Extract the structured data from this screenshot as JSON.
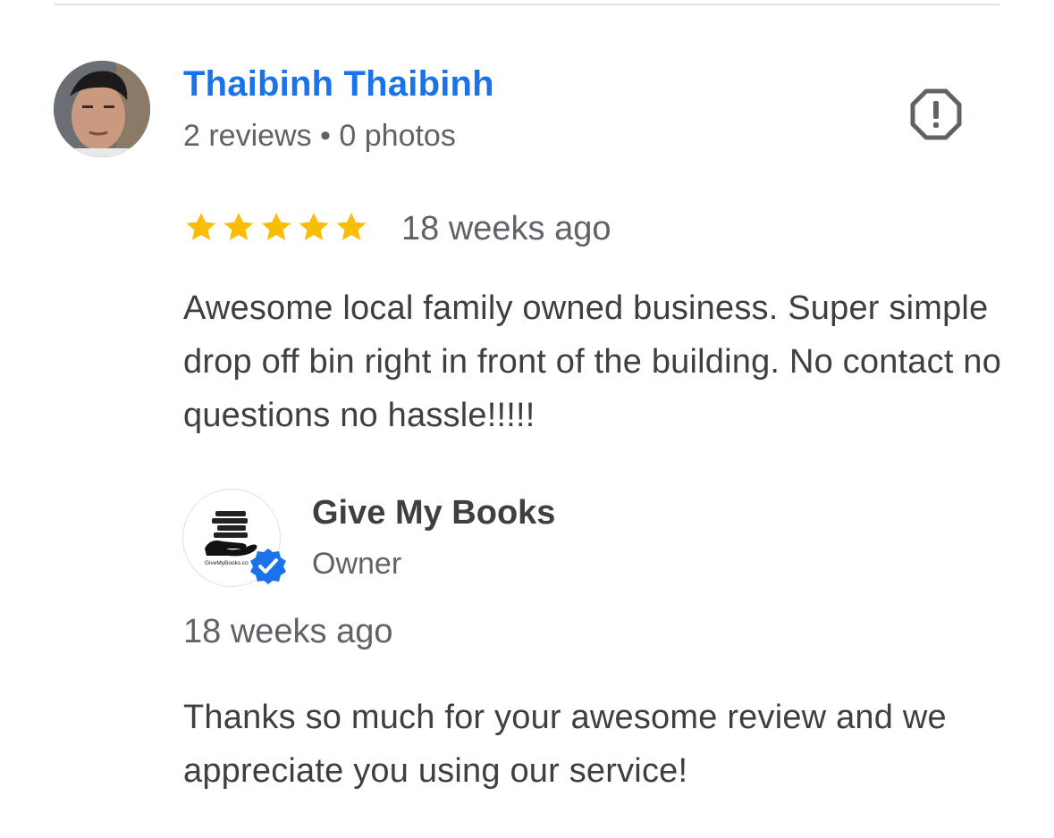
{
  "review": {
    "reviewer_name": "Thaibinh Thaibinh",
    "reviewer_meta": "2 reviews • 0 photos",
    "rating": 5,
    "max_rating": 5,
    "time": "18 weeks ago",
    "text": "Awesome local family owned business. Super simple drop off bin right in front of the building. No contact no questions no hassle!!!!!",
    "report_icon": "report-icon"
  },
  "owner_reply": {
    "name": "Give My Books",
    "role": "Owner",
    "logo_text": "GiveMyBooks.co",
    "time": "18 weeks ago",
    "text": "Thanks so much for your awesome review and we appreciate you using our service!"
  },
  "colors": {
    "link_blue": "#1a73e8",
    "star_gold": "#fbbc04",
    "verified_blue": "#1a73e8",
    "text_dark": "#3c4043",
    "text_muted": "#5f6368"
  }
}
